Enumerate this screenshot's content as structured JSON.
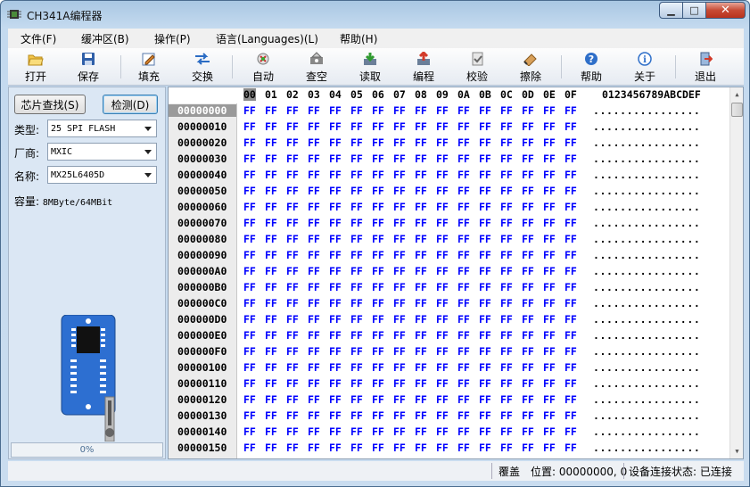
{
  "window": {
    "title": "CH341A编程器",
    "min_label": "▁",
    "max_label": "□",
    "close_label": "✕"
  },
  "menu": [
    "文件(F)",
    "缓冲区(B)",
    "操作(P)",
    "语言(Languages)(L)",
    "帮助(H)"
  ],
  "toolbar": [
    {
      "label": "打开",
      "icon": "open-folder-icon"
    },
    {
      "label": "保存",
      "icon": "save-disk-icon"
    },
    {
      "label": "填充",
      "icon": "fill-edit-icon"
    },
    {
      "label": "交换",
      "icon": "swap-arrows-icon"
    },
    {
      "label": "自动",
      "icon": "auto-icon"
    },
    {
      "label": "查空",
      "icon": "blank-check-icon"
    },
    {
      "label": "读取",
      "icon": "read-icon"
    },
    {
      "label": "编程",
      "icon": "program-icon"
    },
    {
      "label": "校验",
      "icon": "verify-icon"
    },
    {
      "label": "擦除",
      "icon": "erase-icon"
    },
    {
      "label": "帮助",
      "icon": "help-icon"
    },
    {
      "label": "关于",
      "icon": "about-icon"
    },
    {
      "label": "退出",
      "icon": "exit-icon"
    }
  ],
  "left": {
    "search_button": "芯片查找(S)",
    "detect_button": "检测(D)",
    "type_label": "类型:",
    "type_value": "25 SPI FLASH",
    "vendor_label": "厂商:",
    "vendor_value": "MXIC",
    "name_label": "名称:",
    "name_value": "MX25L6405D",
    "capacity_label": "容量:",
    "capacity_value": "8MByte/64MBit",
    "progress_text": "0%",
    "progress_value": 0
  },
  "hex": {
    "header_cols": [
      "00",
      "01",
      "02",
      "03",
      "04",
      "05",
      "06",
      "07",
      "08",
      "09",
      "0A",
      "0B",
      "0C",
      "0D",
      "0E",
      "0F"
    ],
    "ascii_header": "0123456789ABCDEF",
    "addresses": [
      "00000000",
      "00000010",
      "00000020",
      "00000030",
      "00000040",
      "00000050",
      "00000060",
      "00000070",
      "00000080",
      "00000090",
      "000000A0",
      "000000B0",
      "000000C0",
      "000000D0",
      "000000E0",
      "000000F0",
      "00000100",
      "00000110",
      "00000120",
      "00000130",
      "00000140",
      "00000150"
    ],
    "byte_value": "FF",
    "ascii_row": "................"
  },
  "status": {
    "mode": "覆盖",
    "position": "位置: 00000000, 0",
    "connection": "设备连接状态: 已连接"
  },
  "colors": {
    "byte_blue": "#0000ff",
    "window_frame": "#c4daef"
  }
}
